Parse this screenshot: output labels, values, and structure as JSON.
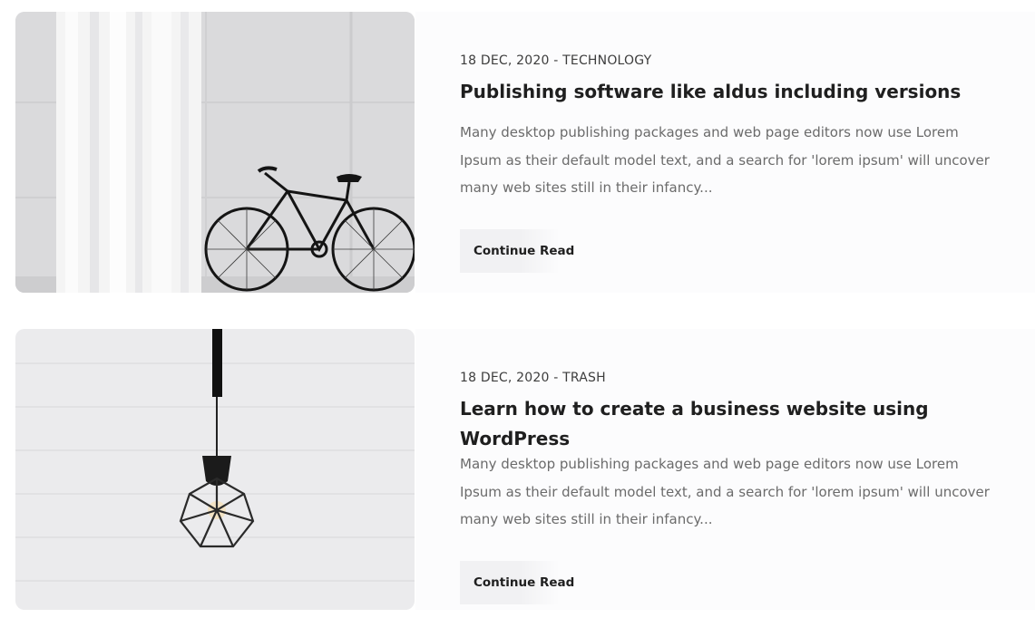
{
  "posts": [
    {
      "image": "bicycle-photo",
      "meta": "18 DEC, 2020 - TECHNOLOGY",
      "title": "Publishing software like aldus including versions",
      "excerpt": "Many desktop publishing packages and web page editors now use Lorem Ipsum as their default model text, and a search for 'lorem ipsum' will uncover many web sites still in their infancy...",
      "button_label": "Continue Read"
    },
    {
      "image": "pendant-lamp-photo",
      "meta": "18 DEC, 2020 - TRASH",
      "title": "Learn how to create a business website using WordPress",
      "excerpt": "Many desktop publishing packages and web page editors now use Lorem Ipsum as their default model text, and a search for 'lorem ipsum' will uncover many web sites still in their infancy...",
      "button_label": "Continue Read"
    }
  ]
}
